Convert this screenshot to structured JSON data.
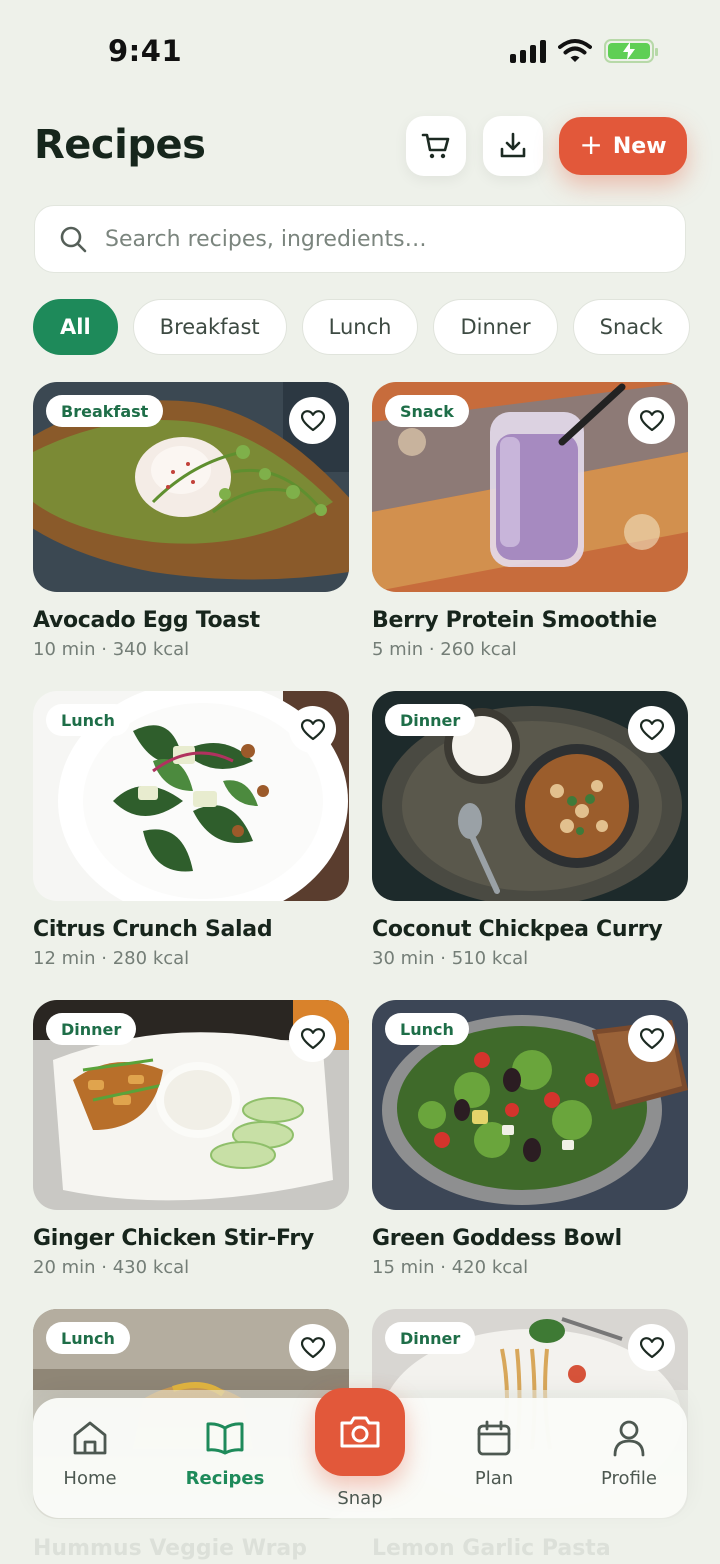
{
  "status_bar": {
    "time": "9:41"
  },
  "header": {
    "title": "Recipes",
    "cart_icon": "cart-icon",
    "download_icon": "download-icon",
    "new_button": {
      "icon": "+",
      "label": "New"
    }
  },
  "search": {
    "placeholder": "Search recipes, ingredients…",
    "value": ""
  },
  "filters": [
    {
      "label": "All",
      "active": true
    },
    {
      "label": "Breakfast",
      "active": false
    },
    {
      "label": "Lunch",
      "active": false
    },
    {
      "label": "Dinner",
      "active": false
    },
    {
      "label": "Snack",
      "active": false
    }
  ],
  "recipes": [
    {
      "tag": "Breakfast",
      "title": "Avocado Egg Toast",
      "meta": "10 min · 340 kcal"
    },
    {
      "tag": "Snack",
      "title": "Berry Protein Smoothie",
      "meta": "5 min · 260 kcal"
    },
    {
      "tag": "Lunch",
      "title": "Citrus Crunch Salad",
      "meta": "12 min · 280 kcal"
    },
    {
      "tag": "Dinner",
      "title": "Coconut Chickpea Curry",
      "meta": "30 min · 510 kcal"
    },
    {
      "tag": "Dinner",
      "title": "Ginger Chicken Stir-Fry",
      "meta": "20 min · 430 kcal"
    },
    {
      "tag": "Lunch",
      "title": "Green Goddess Bowl",
      "meta": "15 min · 420 kcal"
    },
    {
      "tag": "Lunch",
      "title": "Hummus Veggie Wrap"
    },
    {
      "tag": "Dinner",
      "title": "Lemon Garlic Pasta"
    }
  ],
  "tabbar": {
    "home": "Home",
    "recipes": "Recipes",
    "snap": "Snap",
    "plan": "Plan",
    "profile": "Profile"
  },
  "colors": {
    "accent": "#e2583a",
    "primary": "#1e8a5a",
    "background": "#eef1ea"
  }
}
